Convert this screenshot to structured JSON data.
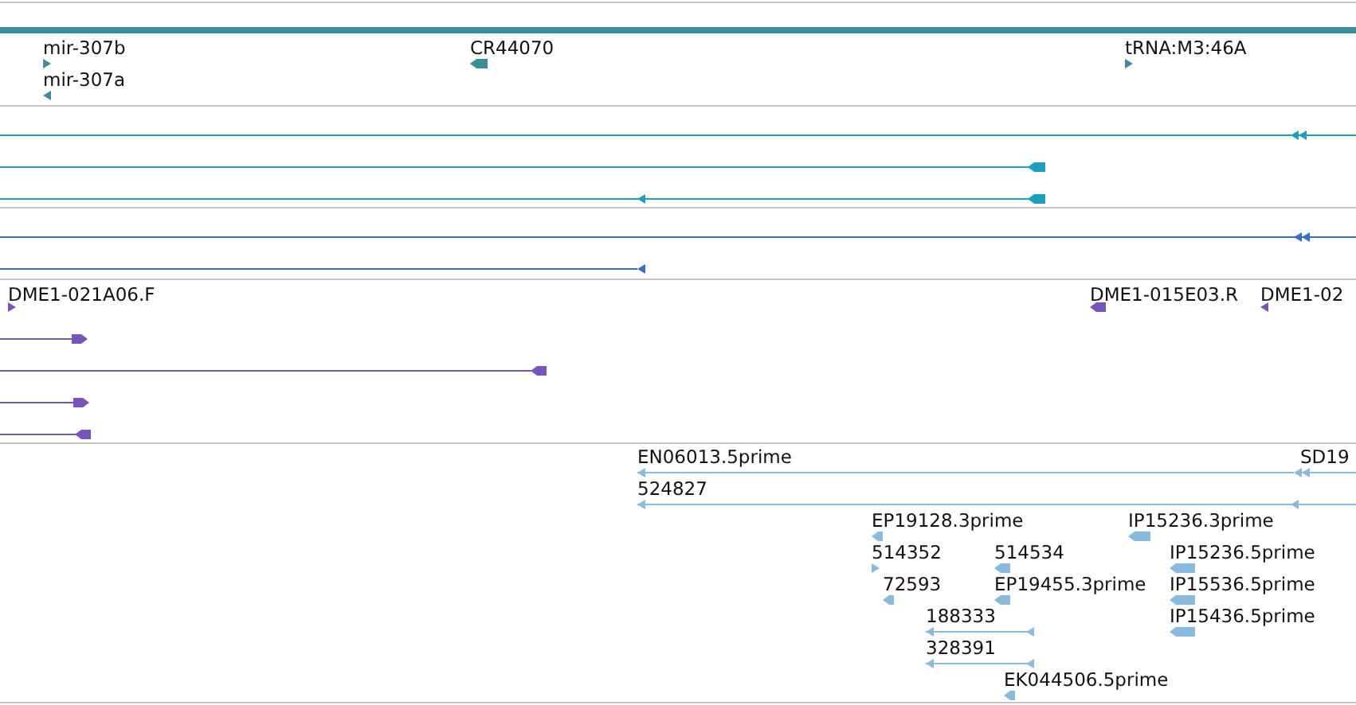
{
  "tracks": [
    {
      "color": "#3a8f96",
      "features": [
        {
          "label": "mir-307b",
          "reverse": false
        },
        {
          "label": "mir-307a",
          "reverse": true
        },
        {
          "label": "CR44070",
          "reverse": true
        },
        {
          "label": "tRNA:M3:46A",
          "reverse": false
        }
      ]
    },
    {
      "color": "#1a9fc0",
      "features": [
        {
          "reverse": true
        },
        {
          "reverse": true
        },
        {
          "reverse": true
        }
      ]
    },
    {
      "color": "#3a6ccc",
      "features": [
        {
          "reverse": true
        },
        {
          "reverse": true
        }
      ]
    },
    {
      "color": "#7755bb",
      "features": [
        {
          "label": "DME1-021A06.F",
          "reverse": false
        },
        {
          "label": "DME1-015E03.R",
          "reverse": true
        },
        {
          "label": "DME1-02",
          "reverse": true
        },
        {
          "reverse": false
        },
        {
          "reverse": true
        },
        {
          "reverse": false
        },
        {
          "reverse": true
        }
      ]
    },
    {
      "color": "#88bbdd",
      "features": [
        {
          "label": "EN06013.5prime",
          "reverse": true
        },
        {
          "label": "SD19",
          "reverse": true
        },
        {
          "label": "524827",
          "reverse": true
        },
        {
          "label": "EP19128.3prime",
          "reverse": true
        },
        {
          "label": "IP15236.3prime",
          "reverse": true
        },
        {
          "label": "514352",
          "reverse": false
        },
        {
          "label": "514534",
          "reverse": true
        },
        {
          "label": "IP15236.5prime",
          "reverse": true
        },
        {
          "label": "72593",
          "reverse": true
        },
        {
          "label": "EP19455.3prime",
          "reverse": true
        },
        {
          "label": "IP15536.5prime",
          "reverse": true
        },
        {
          "label": "188333",
          "reverse": true
        },
        {
          "label": "IP15436.5prime",
          "reverse": true
        },
        {
          "label": "328391",
          "reverse": true
        },
        {
          "label": "EK044506.5prime",
          "reverse": true
        }
      ]
    }
  ]
}
